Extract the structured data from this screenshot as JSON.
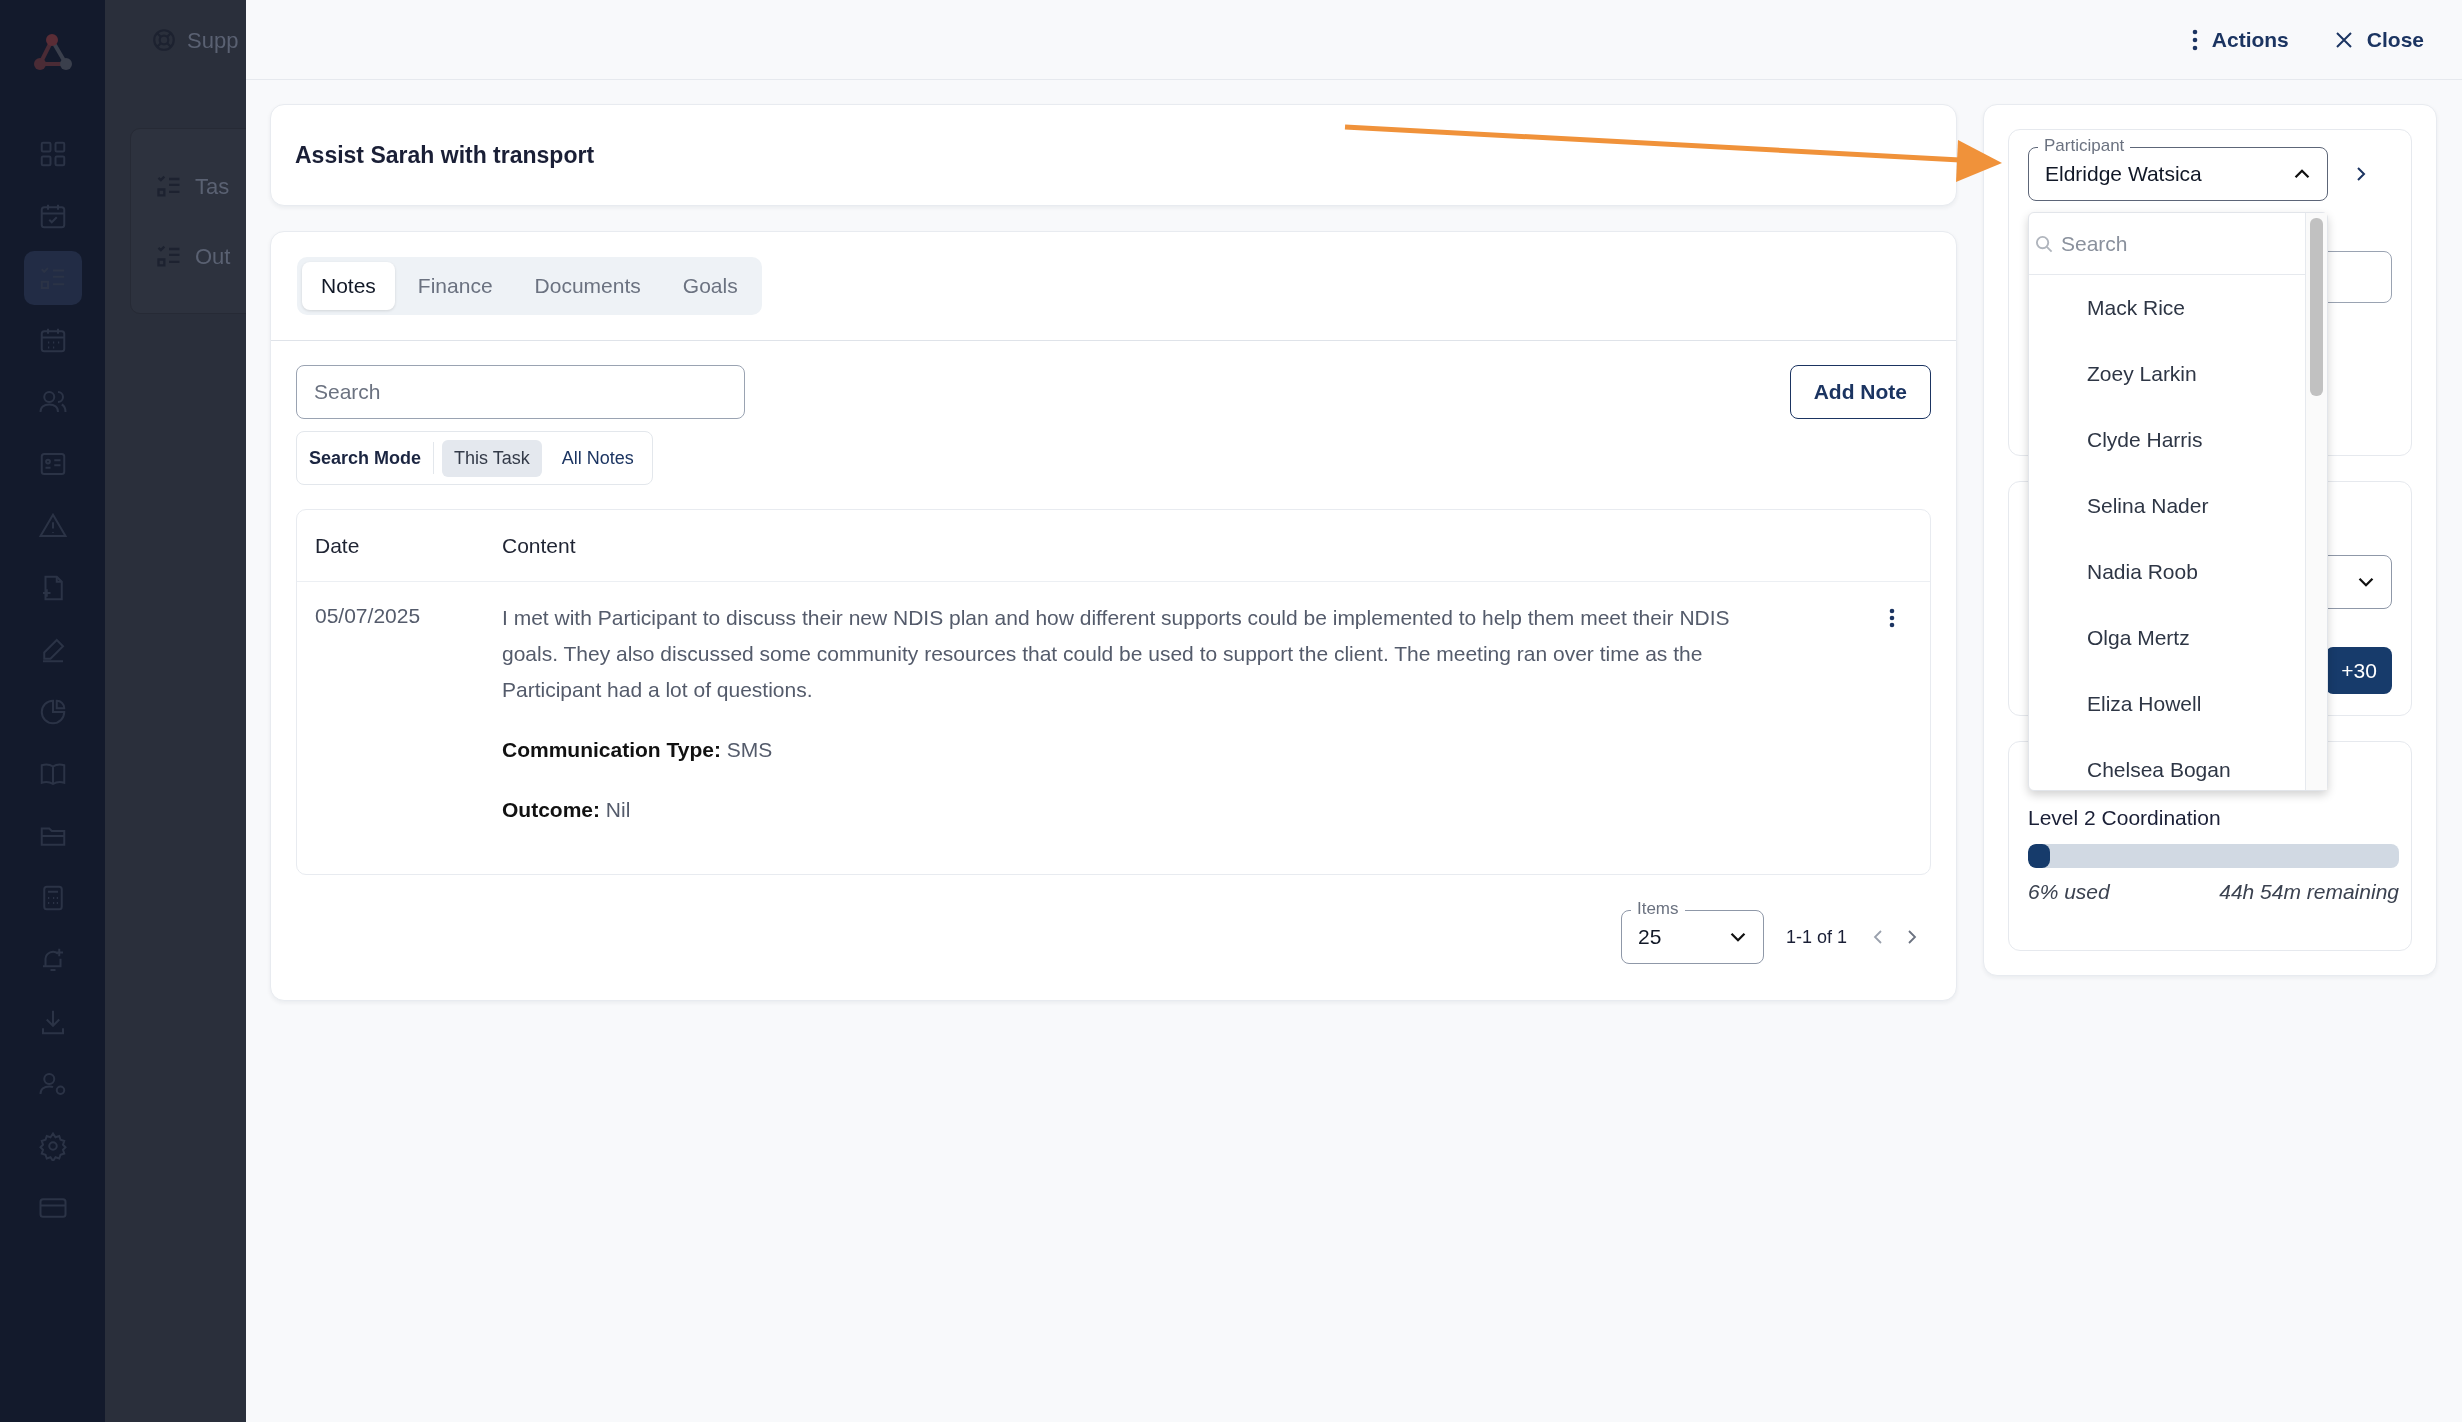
{
  "background_page": {
    "header_text": "Supp",
    "items": [
      "Tas",
      "Out"
    ]
  },
  "nav_items": [
    {
      "selected": false
    },
    {
      "selected": false
    },
    {
      "selected": true
    },
    {
      "selected": false
    },
    {
      "selected": false
    },
    {
      "selected": false
    },
    {
      "selected": false
    },
    {
      "selected": false
    },
    {
      "selected": false
    },
    {
      "selected": false
    },
    {
      "selected": false
    },
    {
      "selected": false
    },
    {
      "selected": false
    },
    {
      "selected": false
    },
    {
      "selected": false
    },
    {
      "selected": false
    },
    {
      "selected": false
    },
    {
      "selected": false
    }
  ],
  "header_actions": [
    {
      "kind": "menu",
      "label": "Actions"
    },
    {
      "kind": "close",
      "label": "Close"
    }
  ],
  "task_title": "Assist Sarah with transport",
  "tabs": [
    {
      "label": "Notes",
      "selected": true
    },
    {
      "label": "Finance",
      "selected": false
    },
    {
      "label": "Documents",
      "selected": false
    },
    {
      "label": "Goals",
      "selected": false
    }
  ],
  "notes_search": {
    "placeholder": "Search"
  },
  "add_note_button": "Add Note",
  "search_mode": {
    "label": "Search Mode",
    "options": [
      {
        "label": "This Task",
        "selected": true
      },
      {
        "label": "All Notes",
        "selected": false
      }
    ]
  },
  "table": {
    "columns": [
      "Date",
      "Content"
    ],
    "rows": [
      {
        "date": "05/07/2025",
        "content": "I met with Participant to discuss their new NDIS plan and how different supports could be implemented to help them meet their NDIS goals. They also discussed some community resources that could be used to support the client. The meeting ran over time as the Participant had a lot of questions.",
        "fields": [
          "**Communication Type:** SMS",
          "**Outcome:** Nil"
        ]
      }
    ]
  },
  "pagination": {
    "items_label": "Items",
    "items_value": "25",
    "range": "1-1 of 1"
  },
  "participant": {
    "label": "Participant",
    "value": "Eldridge Watsica",
    "expanded": true,
    "search_placeholder": "Search",
    "options": [
      "Mack Rice",
      "Zoey Larkin",
      "Clyde Harris",
      "Selina Nader",
      "Nadia Roob",
      "Olga Mertz",
      "Eliza Howell",
      "Chelsea Bogan"
    ]
  },
  "allocation_button": "+30",
  "budget": {
    "name": "Level 2 Coordination",
    "level": 0.06,
    "used": "6% used",
    "remaining": "44h 54m remaining"
  }
}
